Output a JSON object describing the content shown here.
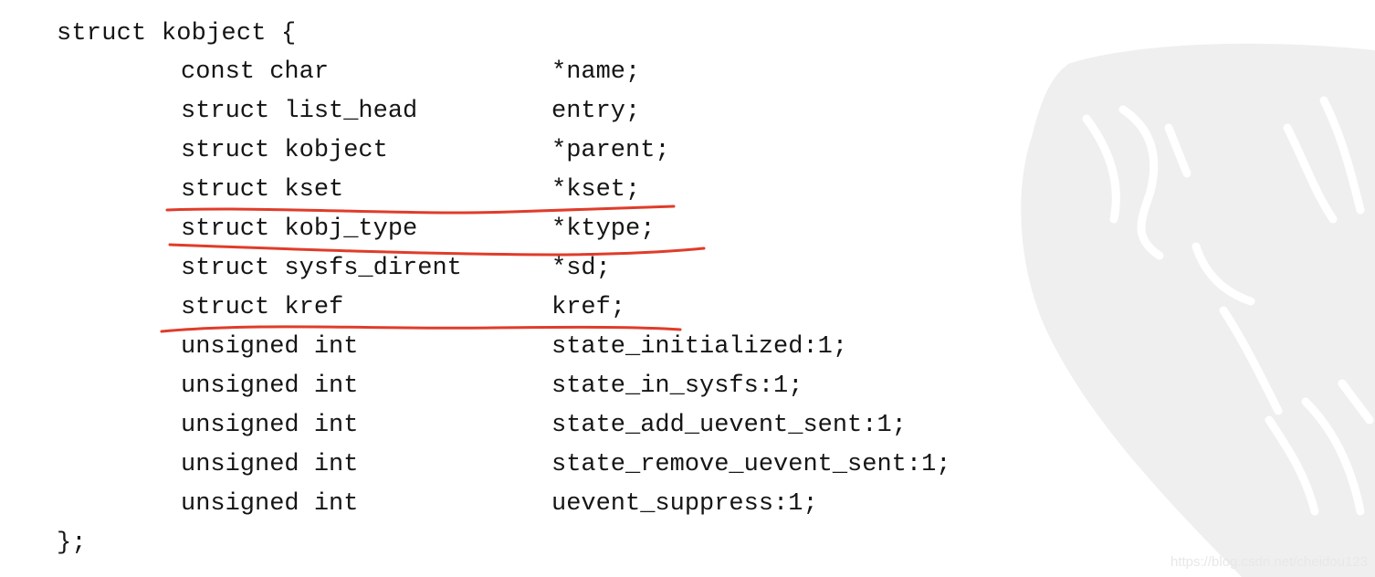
{
  "code": {
    "open_line": "struct kobject {",
    "close_line": "};",
    "fields": [
      {
        "type": "const char",
        "name": "*name;",
        "underlined": false
      },
      {
        "type": "struct list_head",
        "name": "entry;",
        "underlined": false
      },
      {
        "type": "struct kobject",
        "name": "*parent;",
        "underlined": false
      },
      {
        "type": "struct kset",
        "name": "*kset;",
        "underlined": true
      },
      {
        "type": "struct kobj_type",
        "name": "*ktype;",
        "underlined": true
      },
      {
        "type": "struct sysfs_dirent",
        "name": "*sd;",
        "underlined": false
      },
      {
        "type": "struct kref",
        "name": "kref;",
        "underlined": true
      },
      {
        "type": "unsigned int",
        "name": "state_initialized:1;",
        "underlined": false
      },
      {
        "type": "unsigned int",
        "name": "state_in_sysfs:1;",
        "underlined": false
      },
      {
        "type": "unsigned int",
        "name": "state_add_uevent_sent:1;",
        "underlined": false
      },
      {
        "type": "unsigned int",
        "name": "state_remove_uevent_sent:1;",
        "underlined": false
      },
      {
        "type": "unsigned int",
        "name": "uevent_suppress:1;",
        "underlined": false
      }
    ]
  },
  "annotation_color": "#e03c2a",
  "watermark_color": "#efefef",
  "credit_text": "https://blog.csdn.net/cheidou123"
}
